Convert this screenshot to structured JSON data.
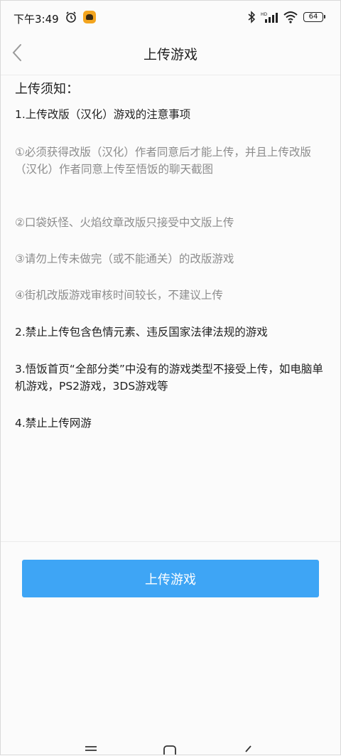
{
  "status_bar": {
    "time": "下午3:49",
    "battery": "64",
    "icons": [
      "alarm-icon",
      "app-notification-icon",
      "bluetooth-icon",
      "signal-icon",
      "wifi-icon",
      "battery-icon"
    ]
  },
  "header": {
    "title": "上传游戏",
    "back_icon": "chevron-left-icon"
  },
  "notice": {
    "heading": "上传须知：",
    "rules": [
      {
        "text": "1.上传改版（汉化）游戏的注意事项",
        "style": "main"
      },
      {
        "text": "①必须获得改版（汉化）作者同意后才能上传，并且上传改版（汉化）作者同意上传至悟饭的聊天截图",
        "style": "sub"
      },
      {
        "text": "②口袋妖怪、火焰纹章改版只接受中文版上传",
        "style": "sub"
      },
      {
        "text": "③请勿上传未做完（或不能通关）的改版游戏",
        "style": "sub"
      },
      {
        "text": "④街机改版游戏审核时间较长，不建议上传",
        "style": "sub"
      },
      {
        "text": "2.禁止上传包含色情元素、违反国家法律法规的游戏",
        "style": "main"
      },
      {
        "text": "3.悟饭首页“全部分类”中没有的游戏类型不接受上传，如电脑单机游戏，PS2游戏，3DS游戏等",
        "style": "main"
      },
      {
        "text": "4.禁止上传网游",
        "style": "main"
      }
    ]
  },
  "footer": {
    "upload_button": "上传游戏"
  },
  "system_nav": [
    "menu-icon",
    "home-icon",
    "back-icon"
  ],
  "colors": {
    "accent": "#3ea5f5",
    "text_primary": "#222222",
    "text_secondary": "#8c8c8c"
  }
}
